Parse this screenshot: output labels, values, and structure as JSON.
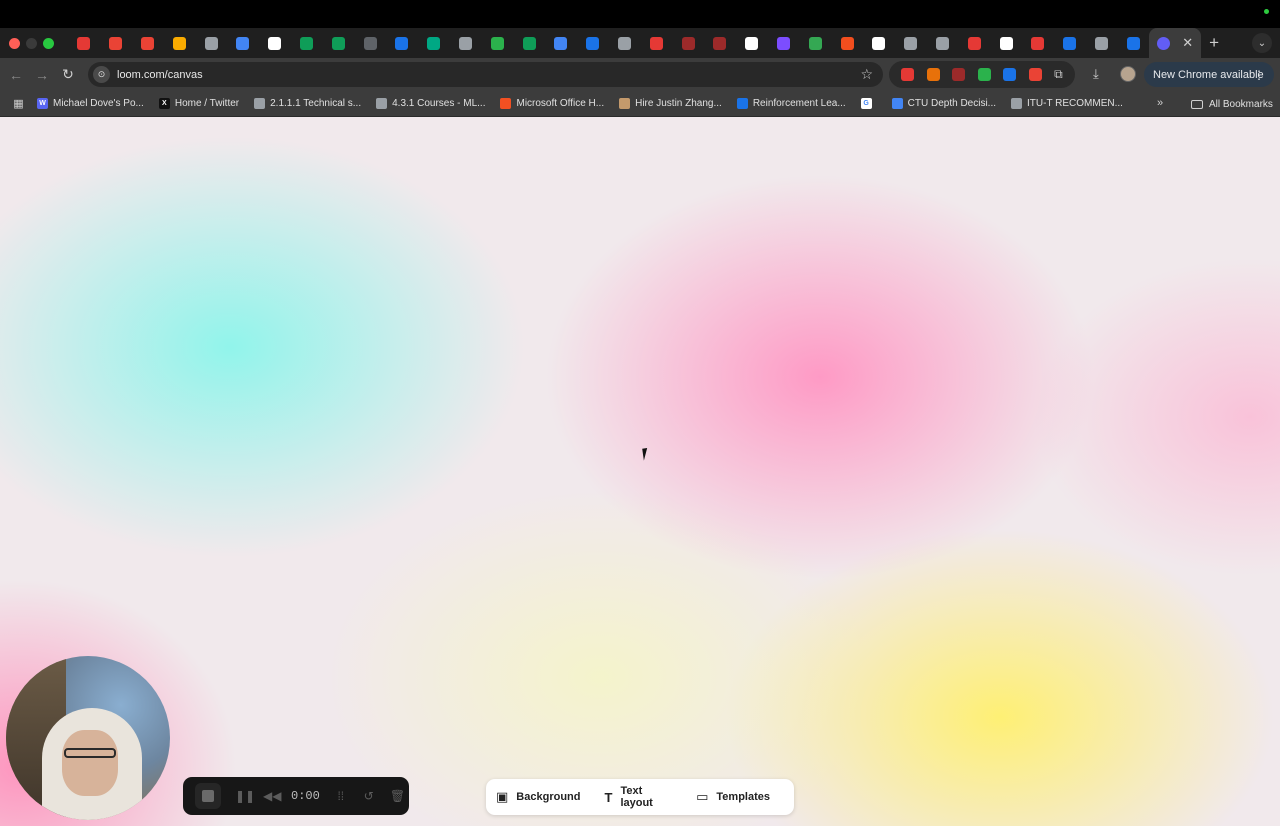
{
  "browser": {
    "tabs": [
      {
        "icon": "opera-icon",
        "color": "#e53935"
      },
      {
        "icon": "gmail-icon",
        "color": "#ea4335"
      },
      {
        "icon": "gmail-icon",
        "color": "#ea4335"
      },
      {
        "icon": "analytics-icon",
        "color": "#f9ab00"
      },
      {
        "icon": "car-icon",
        "color": "#9aa0a6"
      },
      {
        "icon": "google-ads-icon",
        "color": "#4285f4"
      },
      {
        "icon": "google-icon",
        "color": "#ffffff"
      },
      {
        "icon": "sheets-icon",
        "color": "#0f9d58"
      },
      {
        "icon": "sheets-icon",
        "color": "#0f9d58"
      },
      {
        "icon": "globe-icon",
        "color": "#5f6368"
      },
      {
        "icon": "doc-blue-icon",
        "color": "#1a73e8"
      },
      {
        "icon": "flag-icon",
        "color": "#00a884"
      },
      {
        "icon": "openai-icon",
        "color": "#9aa0a6"
      },
      {
        "icon": "feedly-icon",
        "color": "#2bb24c"
      },
      {
        "icon": "sheets-icon",
        "color": "#0f9d58"
      },
      {
        "icon": "docs-icon",
        "color": "#4285f4"
      },
      {
        "icon": "doc-blue-icon",
        "color": "#1a73e8"
      },
      {
        "icon": "openai-icon",
        "color": "#9aa0a6"
      },
      {
        "icon": "red-circle-icon",
        "color": "#e53935"
      },
      {
        "icon": "dark-circle-icon",
        "color": "#9c2a2a"
      },
      {
        "icon": "dark-circle-icon",
        "color": "#9c2a2a"
      },
      {
        "icon": "grid-icon",
        "color": "#ffffff"
      },
      {
        "icon": "purple-circle-icon",
        "color": "#7c4dff"
      },
      {
        "icon": "hand-icon",
        "color": "#34a853"
      },
      {
        "icon": "figma-icon",
        "color": "#f24e1e"
      },
      {
        "icon": "x-icon",
        "color": "#ffffff"
      },
      {
        "icon": "openai-icon",
        "color": "#9aa0a6"
      },
      {
        "icon": "openai-icon",
        "color": "#9aa0a6"
      },
      {
        "icon": "swirl-icon",
        "color": "#e53935"
      },
      {
        "icon": "threads-icon",
        "color": "#ffffff"
      },
      {
        "icon": "u-icon",
        "color": "#e53935"
      },
      {
        "icon": "card-icon",
        "color": "#1a73e8"
      },
      {
        "icon": "c-icon",
        "color": "#9aa0a6"
      },
      {
        "icon": "doc-blue-icon",
        "color": "#1a73e8"
      }
    ],
    "active_tab_icon": "loom-icon",
    "active_tab_close": "✕",
    "new_tab": "+",
    "url": "loom.com/canvas",
    "update_label": "New Chrome available",
    "extensions": [
      "#e53935",
      "#e8710a",
      "#9c2a2a",
      "#2bb24c",
      "#1a73e8",
      "#ea4335"
    ]
  },
  "bookmarks": [
    {
      "label": "Michael Dove's Po...",
      "icon": "w-icon",
      "color": "#5865f2",
      "glyph": "W"
    },
    {
      "label": "Home / Twitter",
      "icon": "x-icon",
      "color": "#111111",
      "glyph": "X"
    },
    {
      "label": "2.1.1.1 Technical s...",
      "icon": "book-icon",
      "color": "#9aa0a6",
      "glyph": ""
    },
    {
      "label": "4.3.1 Courses - ML...",
      "icon": "book-icon",
      "color": "#9aa0a6",
      "glyph": ""
    },
    {
      "label": "Microsoft Office H...",
      "icon": "microsoft-icon",
      "color": "#f25022",
      "glyph": ""
    },
    {
      "label": "Hire Justin Zhang...",
      "icon": "person-icon",
      "color": "#c49a6c",
      "glyph": ""
    },
    {
      "label": "Reinforcement Lea...",
      "icon": "circle-blue-icon",
      "color": "#1a73e8",
      "glyph": ""
    },
    {
      "label": "",
      "icon": "google-icon",
      "color": "#ffffff",
      "glyph": "G"
    },
    {
      "label": "CTU Depth Decisi...",
      "icon": "file-icon",
      "color": "#4285f4",
      "glyph": ""
    },
    {
      "label": "ITU-T RECOMMEN...",
      "icon": "globe-icon",
      "color": "#9aa0a6",
      "glyph": ""
    }
  ],
  "bookmarks_all": "All Bookmarks",
  "recorder": {
    "timer": "0:00"
  },
  "canvas_toolbar": {
    "background": "Background",
    "text_layout": "Text layout",
    "templates": "Templates"
  }
}
